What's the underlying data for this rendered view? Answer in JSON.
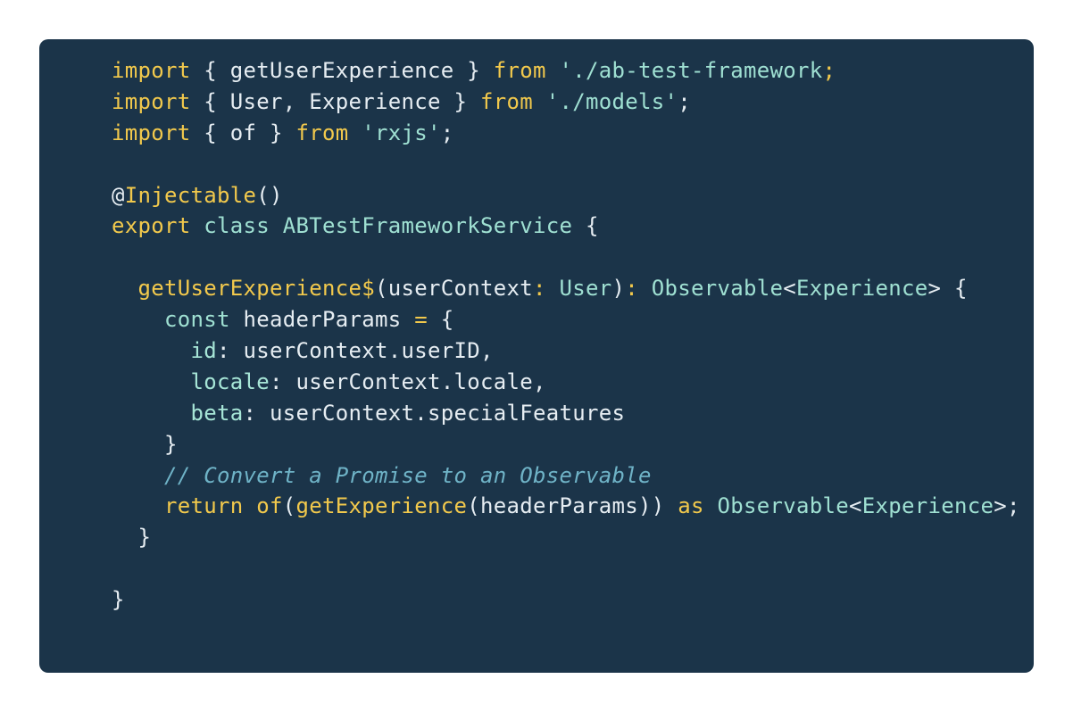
{
  "code": {
    "lines": [
      [
        {
          "t": "kw",
          "v": "import"
        },
        {
          "t": "plain",
          "v": " { getUserExperience } "
        },
        {
          "t": "kw",
          "v": "from"
        },
        {
          "t": "plain",
          "v": " "
        },
        {
          "t": "str",
          "v": "'./ab-test-framework"
        },
        {
          "t": "kw",
          "v": ";"
        }
      ],
      [
        {
          "t": "kw",
          "v": "import"
        },
        {
          "t": "plain",
          "v": " { User, Experience } "
        },
        {
          "t": "kw",
          "v": "from"
        },
        {
          "t": "plain",
          "v": " "
        },
        {
          "t": "str",
          "v": "'./models'"
        },
        {
          "t": "plain",
          "v": ";"
        }
      ],
      [
        {
          "t": "kw",
          "v": "import"
        },
        {
          "t": "plain",
          "v": " { of } "
        },
        {
          "t": "kw",
          "v": "from"
        },
        {
          "t": "plain",
          "v": " "
        },
        {
          "t": "str",
          "v": "'rxjs'"
        },
        {
          "t": "plain",
          "v": ";"
        }
      ],
      [
        {
          "t": "plain",
          "v": ""
        }
      ],
      [
        {
          "t": "plain",
          "v": "@"
        },
        {
          "t": "fn",
          "v": "Injectable"
        },
        {
          "t": "plain",
          "v": "()"
        }
      ],
      [
        {
          "t": "kw",
          "v": "export"
        },
        {
          "t": "plain",
          "v": " "
        },
        {
          "t": "type",
          "v": "class"
        },
        {
          "t": "plain",
          "v": " "
        },
        {
          "t": "type",
          "v": "ABTestFrameworkService"
        },
        {
          "t": "plain",
          "v": " {"
        }
      ],
      [
        {
          "t": "plain",
          "v": ""
        }
      ],
      [
        {
          "t": "plain",
          "v": "  "
        },
        {
          "t": "fn",
          "v": "getUserExperience$"
        },
        {
          "t": "plain",
          "v": "(userContext"
        },
        {
          "t": "kw",
          "v": ":"
        },
        {
          "t": "plain",
          "v": " "
        },
        {
          "t": "type",
          "v": "User"
        },
        {
          "t": "plain",
          "v": ")"
        },
        {
          "t": "kw",
          "v": ":"
        },
        {
          "t": "plain",
          "v": " "
        },
        {
          "t": "type",
          "v": "Observable"
        },
        {
          "t": "plain",
          "v": "<"
        },
        {
          "t": "type",
          "v": "Experience"
        },
        {
          "t": "plain",
          "v": "> {"
        }
      ],
      [
        {
          "t": "plain",
          "v": "    "
        },
        {
          "t": "type",
          "v": "const"
        },
        {
          "t": "plain",
          "v": " headerParams "
        },
        {
          "t": "kw",
          "v": "="
        },
        {
          "t": "plain",
          "v": " {"
        }
      ],
      [
        {
          "t": "plain",
          "v": "      "
        },
        {
          "t": "prop",
          "v": "id"
        },
        {
          "t": "plain",
          "v": ": userContext.userID,"
        }
      ],
      [
        {
          "t": "plain",
          "v": "      "
        },
        {
          "t": "prop",
          "v": "locale"
        },
        {
          "t": "plain",
          "v": ": userContext.locale,"
        }
      ],
      [
        {
          "t": "plain",
          "v": "      "
        },
        {
          "t": "prop",
          "v": "beta"
        },
        {
          "t": "plain",
          "v": ": userContext.specialFeatures"
        }
      ],
      [
        {
          "t": "plain",
          "v": "    }"
        }
      ],
      [
        {
          "t": "comment",
          "v": "    // Convert a Promise to an Observable"
        }
      ],
      [
        {
          "t": "plain",
          "v": "    "
        },
        {
          "t": "kw",
          "v": "return"
        },
        {
          "t": "plain",
          "v": " "
        },
        {
          "t": "fn",
          "v": "of"
        },
        {
          "t": "plain",
          "v": "("
        },
        {
          "t": "fn",
          "v": "getExperience"
        },
        {
          "t": "plain",
          "v": "(headerParams)) "
        },
        {
          "t": "kw",
          "v": "as"
        },
        {
          "t": "plain",
          "v": " "
        },
        {
          "t": "type",
          "v": "Observable"
        },
        {
          "t": "plain",
          "v": "<"
        },
        {
          "t": "type",
          "v": "Experience"
        },
        {
          "t": "plain",
          "v": ">;"
        }
      ],
      [
        {
          "t": "plain",
          "v": "  }"
        }
      ],
      [
        {
          "t": "plain",
          "v": ""
        }
      ],
      [
        {
          "t": "plain",
          "v": "}"
        }
      ]
    ]
  },
  "colors": {
    "background": "#1b3449",
    "keyword": "#f2c94c",
    "string": "#9fe0d2",
    "comment": "#6fb3c7",
    "text": "#e6edf2"
  }
}
